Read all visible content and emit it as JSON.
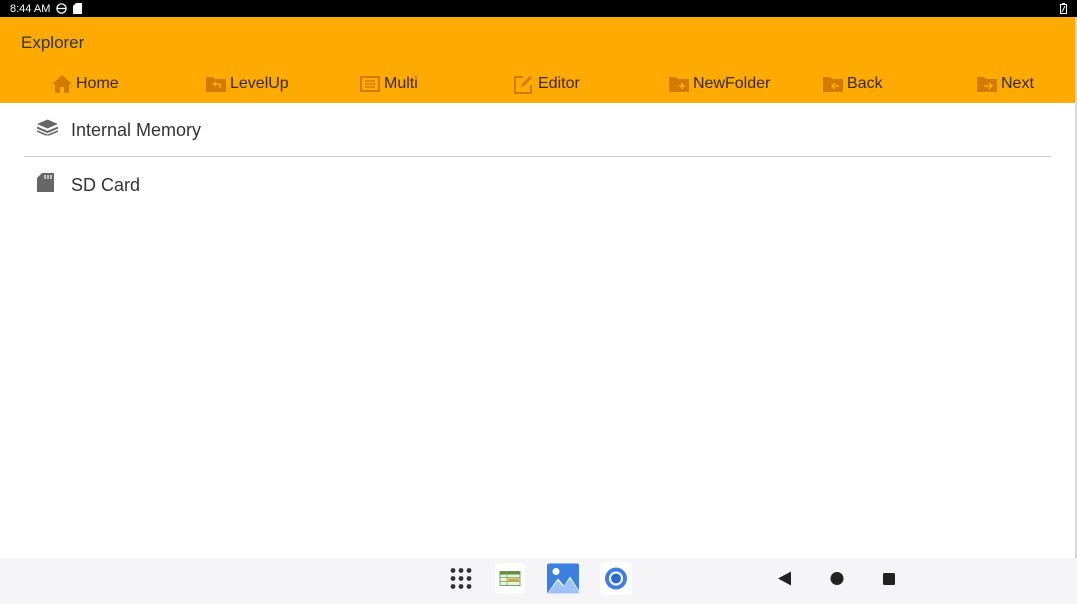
{
  "status_bar": {
    "time": "8:44 AM"
  },
  "app": {
    "title": "Explorer",
    "accent_color": "#FFAA00"
  },
  "toolbar": {
    "buttons": [
      {
        "label": "Home",
        "icon": "home-icon"
      },
      {
        "label": "LevelUp",
        "icon": "folder-up-icon"
      },
      {
        "label": "Multi",
        "icon": "multi-select-icon"
      },
      {
        "label": "Editor",
        "icon": "edit-icon"
      },
      {
        "label": "NewFolder",
        "icon": "new-folder-icon"
      },
      {
        "label": "Back",
        "icon": "folder-back-icon"
      },
      {
        "label": "Next",
        "icon": "folder-next-icon"
      }
    ]
  },
  "list": {
    "items": [
      {
        "label": "Internal Memory",
        "icon": "layers-icon"
      },
      {
        "label": "SD Card",
        "icon": "sd-card-icon"
      }
    ]
  },
  "nav_bar": {
    "apps": [
      "app-drawer-icon",
      "spreadsheet-app-icon",
      "gallery-app-icon",
      "browser-app-icon"
    ],
    "system": [
      "back-icon",
      "home-circle-icon",
      "recents-icon"
    ]
  }
}
